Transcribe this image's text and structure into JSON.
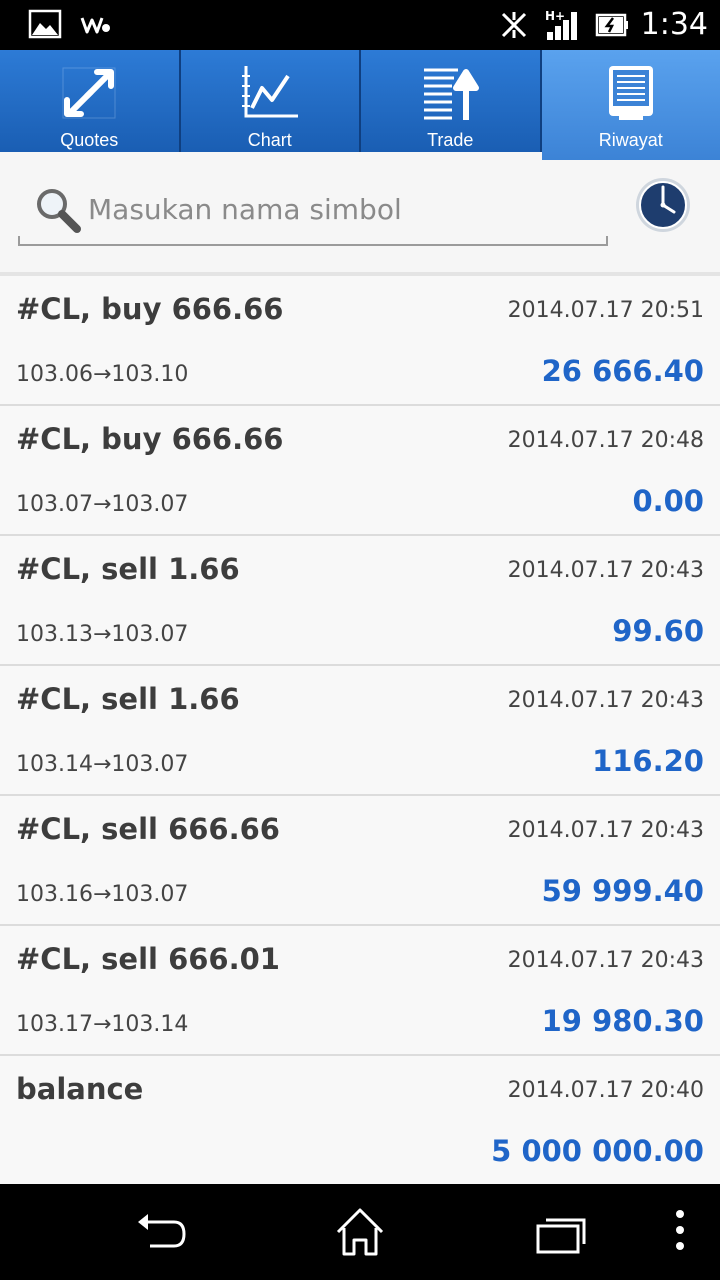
{
  "status_bar": {
    "time": "1:34",
    "icons": [
      "gallery-icon",
      "walkman-icon",
      "data-off-icon",
      "signal-hplus-icon",
      "battery-icon"
    ]
  },
  "tabs": [
    {
      "label": "Quotes",
      "icon": "quotes-icon",
      "active": false
    },
    {
      "label": "Chart",
      "icon": "chart-icon",
      "active": false
    },
    {
      "label": "Trade",
      "icon": "trade-icon",
      "active": false
    },
    {
      "label": "Riwayat",
      "icon": "history-icon",
      "active": true
    }
  ],
  "search": {
    "placeholder": "Masukan nama simbol",
    "value": ""
  },
  "history": [
    {
      "title": "#CL, buy 666.66",
      "time": "2014.07.17 20:51",
      "prices": "103.06→103.10",
      "profit": "26 666.40"
    },
    {
      "title": "#CL, buy 666.66",
      "time": "2014.07.17 20:48",
      "prices": "103.07→103.07",
      "profit": "0.00"
    },
    {
      "title": "#CL, sell 1.66",
      "time": "2014.07.17 20:43",
      "prices": "103.13→103.07",
      "profit": "99.60"
    },
    {
      "title": "#CL, sell 1.66",
      "time": "2014.07.17 20:43",
      "prices": "103.14→103.07",
      "profit": "116.20"
    },
    {
      "title": "#CL, sell 666.66",
      "time": "2014.07.17 20:43",
      "prices": "103.16→103.07",
      "profit": "59 999.40"
    },
    {
      "title": "#CL, sell 666.01",
      "time": "2014.07.17 20:43",
      "prices": "103.17→103.14",
      "profit": "19 980.30"
    },
    {
      "title": "balance",
      "time": "2014.07.17 20:40",
      "prices": "",
      "profit": "5 000 000.00"
    }
  ],
  "colors": {
    "tab_bar": "#1a5eb3",
    "tab_active": "#4a93e3",
    "profit": "#1f65c8"
  }
}
